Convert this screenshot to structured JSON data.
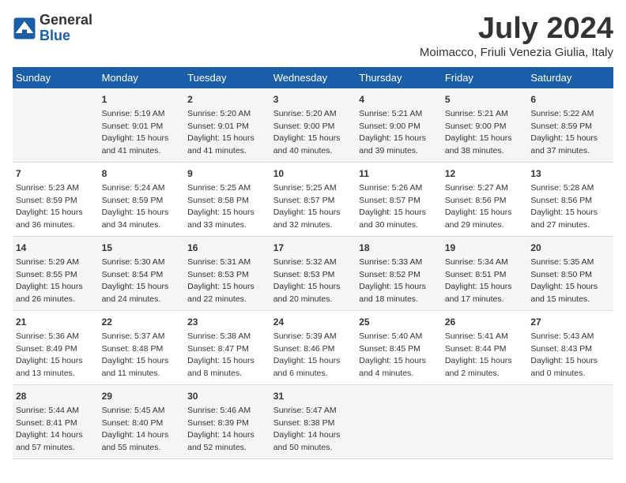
{
  "logo": {
    "general": "General",
    "blue": "Blue"
  },
  "title": "July 2024",
  "subtitle": "Moimacco, Friuli Venezia Giulia, Italy",
  "days_of_week": [
    "Sunday",
    "Monday",
    "Tuesday",
    "Wednesday",
    "Thursday",
    "Friday",
    "Saturday"
  ],
  "weeks": [
    [
      {
        "day": "",
        "sunrise": "",
        "sunset": "",
        "daylight": ""
      },
      {
        "day": "1",
        "sunrise": "5:19 AM",
        "sunset": "9:01 PM",
        "daylight": "15 hours and 41 minutes."
      },
      {
        "day": "2",
        "sunrise": "5:20 AM",
        "sunset": "9:01 PM",
        "daylight": "15 hours and 41 minutes."
      },
      {
        "day": "3",
        "sunrise": "5:20 AM",
        "sunset": "9:00 PM",
        "daylight": "15 hours and 40 minutes."
      },
      {
        "day": "4",
        "sunrise": "5:21 AM",
        "sunset": "9:00 PM",
        "daylight": "15 hours and 39 minutes."
      },
      {
        "day": "5",
        "sunrise": "5:21 AM",
        "sunset": "9:00 PM",
        "daylight": "15 hours and 38 minutes."
      },
      {
        "day": "6",
        "sunrise": "5:22 AM",
        "sunset": "8:59 PM",
        "daylight": "15 hours and 37 minutes."
      }
    ],
    [
      {
        "day": "7",
        "sunrise": "5:23 AM",
        "sunset": "8:59 PM",
        "daylight": "15 hours and 36 minutes."
      },
      {
        "day": "8",
        "sunrise": "5:24 AM",
        "sunset": "8:59 PM",
        "daylight": "15 hours and 34 minutes."
      },
      {
        "day": "9",
        "sunrise": "5:25 AM",
        "sunset": "8:58 PM",
        "daylight": "15 hours and 33 minutes."
      },
      {
        "day": "10",
        "sunrise": "5:25 AM",
        "sunset": "8:57 PM",
        "daylight": "15 hours and 32 minutes."
      },
      {
        "day": "11",
        "sunrise": "5:26 AM",
        "sunset": "8:57 PM",
        "daylight": "15 hours and 30 minutes."
      },
      {
        "day": "12",
        "sunrise": "5:27 AM",
        "sunset": "8:56 PM",
        "daylight": "15 hours and 29 minutes."
      },
      {
        "day": "13",
        "sunrise": "5:28 AM",
        "sunset": "8:56 PM",
        "daylight": "15 hours and 27 minutes."
      }
    ],
    [
      {
        "day": "14",
        "sunrise": "5:29 AM",
        "sunset": "8:55 PM",
        "daylight": "15 hours and 26 minutes."
      },
      {
        "day": "15",
        "sunrise": "5:30 AM",
        "sunset": "8:54 PM",
        "daylight": "15 hours and 24 minutes."
      },
      {
        "day": "16",
        "sunrise": "5:31 AM",
        "sunset": "8:53 PM",
        "daylight": "15 hours and 22 minutes."
      },
      {
        "day": "17",
        "sunrise": "5:32 AM",
        "sunset": "8:53 PM",
        "daylight": "15 hours and 20 minutes."
      },
      {
        "day": "18",
        "sunrise": "5:33 AM",
        "sunset": "8:52 PM",
        "daylight": "15 hours and 18 minutes."
      },
      {
        "day": "19",
        "sunrise": "5:34 AM",
        "sunset": "8:51 PM",
        "daylight": "15 hours and 17 minutes."
      },
      {
        "day": "20",
        "sunrise": "5:35 AM",
        "sunset": "8:50 PM",
        "daylight": "15 hours and 15 minutes."
      }
    ],
    [
      {
        "day": "21",
        "sunrise": "5:36 AM",
        "sunset": "8:49 PM",
        "daylight": "15 hours and 13 minutes."
      },
      {
        "day": "22",
        "sunrise": "5:37 AM",
        "sunset": "8:48 PM",
        "daylight": "15 hours and 11 minutes."
      },
      {
        "day": "23",
        "sunrise": "5:38 AM",
        "sunset": "8:47 PM",
        "daylight": "15 hours and 8 minutes."
      },
      {
        "day": "24",
        "sunrise": "5:39 AM",
        "sunset": "8:46 PM",
        "daylight": "15 hours and 6 minutes."
      },
      {
        "day": "25",
        "sunrise": "5:40 AM",
        "sunset": "8:45 PM",
        "daylight": "15 hours and 4 minutes."
      },
      {
        "day": "26",
        "sunrise": "5:41 AM",
        "sunset": "8:44 PM",
        "daylight": "15 hours and 2 minutes."
      },
      {
        "day": "27",
        "sunrise": "5:43 AM",
        "sunset": "8:43 PM",
        "daylight": "15 hours and 0 minutes."
      }
    ],
    [
      {
        "day": "28",
        "sunrise": "5:44 AM",
        "sunset": "8:41 PM",
        "daylight": "14 hours and 57 minutes."
      },
      {
        "day": "29",
        "sunrise": "5:45 AM",
        "sunset": "8:40 PM",
        "daylight": "14 hours and 55 minutes."
      },
      {
        "day": "30",
        "sunrise": "5:46 AM",
        "sunset": "8:39 PM",
        "daylight": "14 hours and 52 minutes."
      },
      {
        "day": "31",
        "sunrise": "5:47 AM",
        "sunset": "8:38 PM",
        "daylight": "14 hours and 50 minutes."
      },
      {
        "day": "",
        "sunrise": "",
        "sunset": "",
        "daylight": ""
      },
      {
        "day": "",
        "sunrise": "",
        "sunset": "",
        "daylight": ""
      },
      {
        "day": "",
        "sunrise": "",
        "sunset": "",
        "daylight": ""
      }
    ]
  ]
}
